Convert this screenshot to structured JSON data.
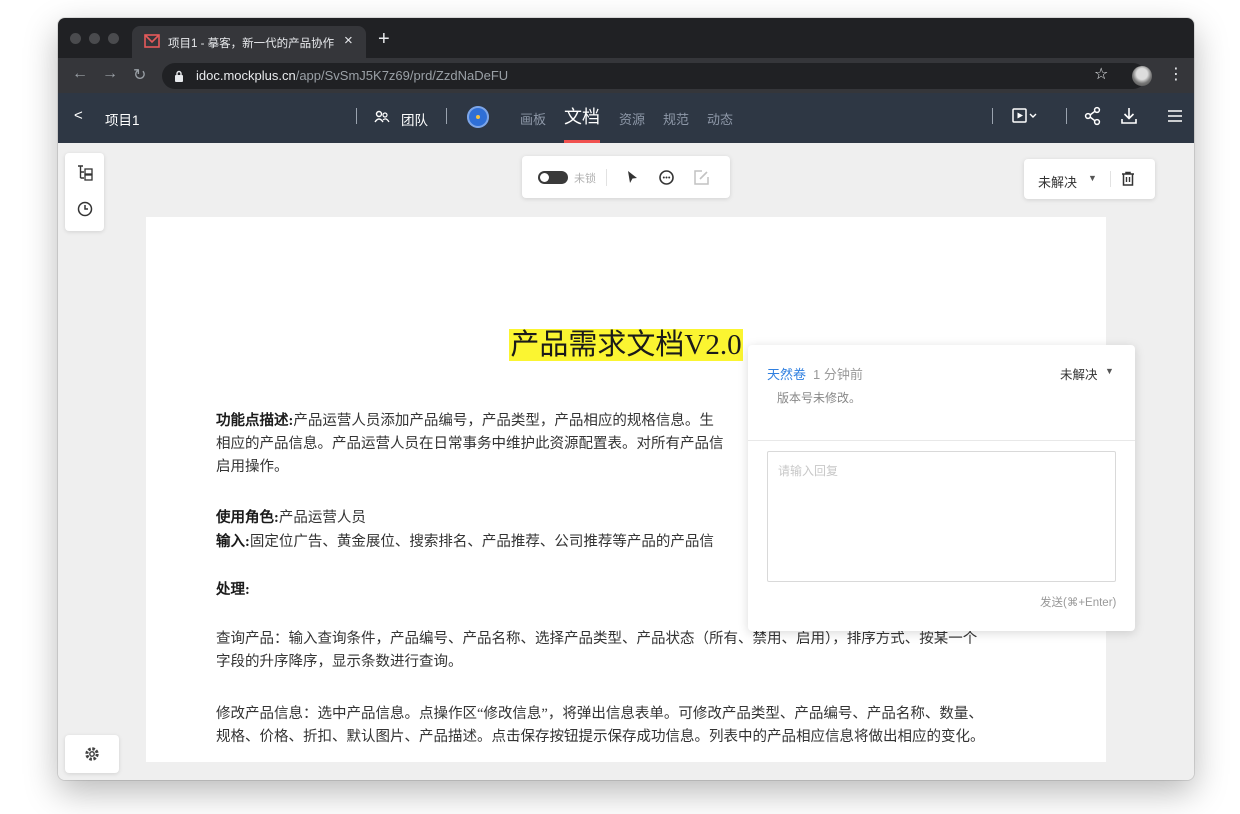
{
  "browser": {
    "tab_title": "项目1 - 摹客，新一代的产品协作",
    "tab_close": "×",
    "new_tab": "+",
    "url_host": "idoc.mockplus.cn",
    "url_path": "/app/SvSmJ5K7z69/prd/ZzdNaDeFU"
  },
  "header": {
    "back": "<",
    "project_name": "项目1",
    "team_label": "团队",
    "tabs": [
      {
        "label": "画板"
      },
      {
        "label": "文档"
      },
      {
        "label": "资源"
      },
      {
        "label": "规范"
      },
      {
        "label": "动态"
      }
    ],
    "active_tab": "文档"
  },
  "toolbar": {
    "lock_label": "未锁"
  },
  "status_filter": {
    "label": "未解决"
  },
  "document": {
    "title": "产品需求文档V2.0",
    "paragraphs": [
      {
        "lead": "功能点描述:",
        "lines": [
          "产品运营人员添加产品编号，产品类型，产品相应的规格信息。生",
          "相应的产品信息。产品运营人员在日常事务中维护此资源配置表。对所有产品信",
          "启用操作。"
        ]
      },
      {
        "lead": "使用角色:",
        "lines": [
          "产品运营人员"
        ]
      },
      {
        "lead": "输入:",
        "lines": [
          "固定位广告、黄金展位、搜索排名、产品推荐、公司推荐等产品的产品信"
        ]
      },
      {
        "lead": "处理:",
        "lines": [
          ""
        ]
      },
      {
        "lead": "",
        "lines": [
          "查询产品：输入查询条件，产品编号、产品名称、选择产品类型、产品状态（所有、禁用、启用），排序方式、按某一个",
          "字段的升序降序，显示条数进行查询。"
        ]
      },
      {
        "lead": "",
        "lines": [
          "修改产品信息：选中产品信息。点操作区“修改信息”，将弹出信息表单。可修改产品类型、产品编号、产品名称、数量、",
          "规格、价格、折扣、默认图片、产品描述。点击保存按钮提示保存成功信息。列表中的产品相应信息将做出相应的变化。"
        ]
      }
    ]
  },
  "comment": {
    "author": "天然卷",
    "time": "1 分钟前",
    "status": "未解决",
    "body": "版本号未修改。",
    "reply_placeholder": "请输入回复",
    "send_label": "发送(⌘+Enter)"
  },
  "colors": {
    "header_bg": "#2e3744",
    "active_tab_underline": "#f0514f",
    "title_highlight": "#fbf531",
    "link_blue": "#2f7fe0"
  }
}
